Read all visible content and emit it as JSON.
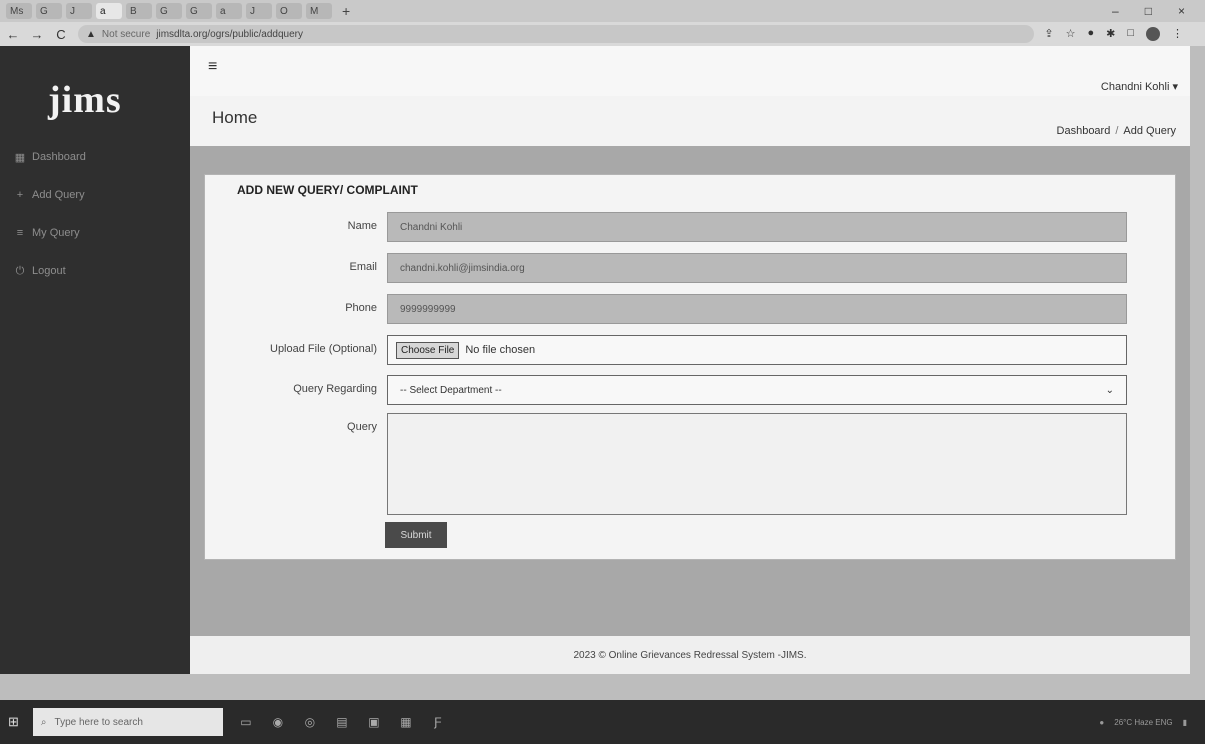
{
  "browser": {
    "tabs": [
      "Ms",
      "G",
      "J",
      "a",
      "B",
      "G",
      "G",
      "a",
      "J",
      "O",
      "M"
    ],
    "new_tab": "+",
    "window_controls": [
      "–",
      "□",
      "×"
    ],
    "nav": {
      "back": "←",
      "forward": "→",
      "reload": "C"
    },
    "security_label": "Not secure",
    "url": "jimsdlta.org/ogrs/public/addquery"
  },
  "sidebar": {
    "logo": "jims",
    "items": [
      {
        "icon": "dashboard-icon",
        "label": "Dashboard"
      },
      {
        "icon": "add-icon",
        "label": "Add Query"
      },
      {
        "icon": "list-icon",
        "label": "My Query"
      },
      {
        "icon": "logout-icon",
        "label": "Logout"
      }
    ]
  },
  "header": {
    "user_name": "Chandni Kohli",
    "page_title": "Home",
    "breadcrumb": [
      "Dashboard",
      "Add Query"
    ]
  },
  "form": {
    "title": "ADD NEW QUERY/ COMPLAINT",
    "name_label": "Name",
    "name_value": "Chandni Kohli",
    "email_label": "Email",
    "email_value": "chandni.kohli@jimsindia.org",
    "phone_label": "Phone",
    "phone_value": "9999999999",
    "upload_label": "Upload File (Optional)",
    "file_button": "Choose File",
    "file_status": "No file chosen",
    "query_regarding_label": "Query Regarding",
    "department_placeholder": "-- Select Department --",
    "query_label": "Query",
    "submit_label": "Submit"
  },
  "footer": {
    "text": "2023 © Online Grievances Redressal System -JIMS."
  },
  "taskbar": {
    "search_placeholder": "Type here to search",
    "tray_text": "26°C Haze  ENG"
  }
}
